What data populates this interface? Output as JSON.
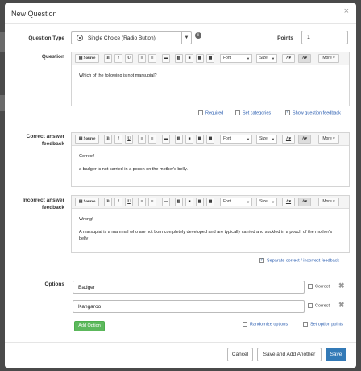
{
  "dialog": {
    "title": "New Question",
    "close": "×"
  },
  "question_type": {
    "label": "Question Type",
    "value": "Single Choice (Radio Button)"
  },
  "points": {
    "label": "Points",
    "value": "1"
  },
  "toolbar": {
    "source": "Source",
    "bold": "B",
    "italic": "I",
    "underline": "U",
    "font": "Font",
    "size": "Size",
    "text_color": "A",
    "bg_color": "A",
    "more": "More"
  },
  "question": {
    "label": "Question",
    "content": "Which of the following is not marsupial?",
    "required": "Required",
    "set_categories": "Set categories",
    "show_feedback": "Show question feedback"
  },
  "correct_feedback": {
    "label_line1": "Correct answer",
    "label_line2": "feedback",
    "line1": "Correct!",
    "line2": "a badger is not carried in a pouch on the mother's belly."
  },
  "incorrect_feedback": {
    "label_line1": "Incorrect answer",
    "label_line2": "feedback",
    "line1": "Wrong!",
    "line2": "A marsupial is a mammal who are not born completely developed and are typically carried and suckled in a pouch of the mother's belly",
    "separate_label": "Separate correct / incorrect feedback"
  },
  "options": {
    "label": "Options",
    "items": [
      {
        "value": "Badger",
        "correct_label": "Correct"
      },
      {
        "value": "Kangaroo",
        "correct_label": "Correct"
      }
    ],
    "add_option": "Add Option",
    "randomize": "Randomize options",
    "set_points": "Set option points"
  },
  "footer": {
    "cancel": "Cancel",
    "save_add": "Save and Add Another",
    "save": "Save"
  },
  "colors": {
    "primary": "#337ab7",
    "success": "#5cb85c",
    "link": "#2a5db0"
  }
}
